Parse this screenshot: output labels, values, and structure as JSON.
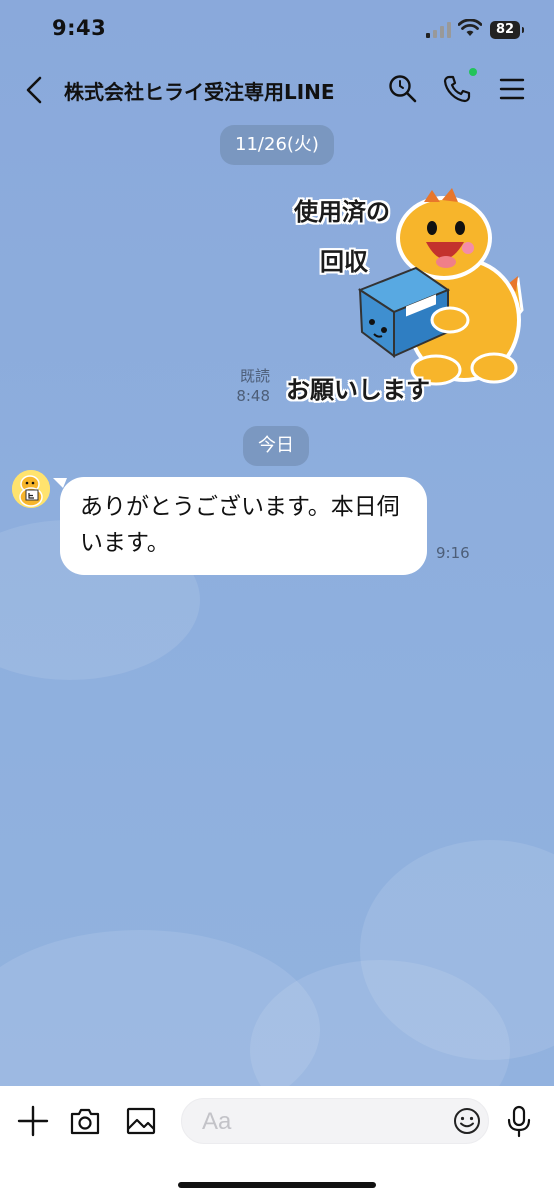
{
  "status": {
    "time": "9:43",
    "battery": "82"
  },
  "header": {
    "title": "株式会社ヒライ受注専用LINE"
  },
  "chat": {
    "date_past": "11/26(火)",
    "sticker": {
      "line1": "使用済の",
      "line2": "回収",
      "line3": "お願いします"
    },
    "read_label": "既読",
    "read_time": "8:48",
    "date_today": "今日",
    "incoming_message": "ありがとうございます。本日伺います。",
    "incoming_time": "9:16"
  },
  "input": {
    "placeholder": "Aa"
  },
  "colors": {
    "background": "#8eaedb",
    "online": "#22c45a",
    "sticker_mascot": "#f7b52b",
    "box": "#3f8fd0"
  },
  "icons": [
    "back-icon",
    "search-icon",
    "phone-icon",
    "menu-icon",
    "plus-icon",
    "camera-icon",
    "image-icon",
    "emoji-icon",
    "microphone-icon"
  ]
}
